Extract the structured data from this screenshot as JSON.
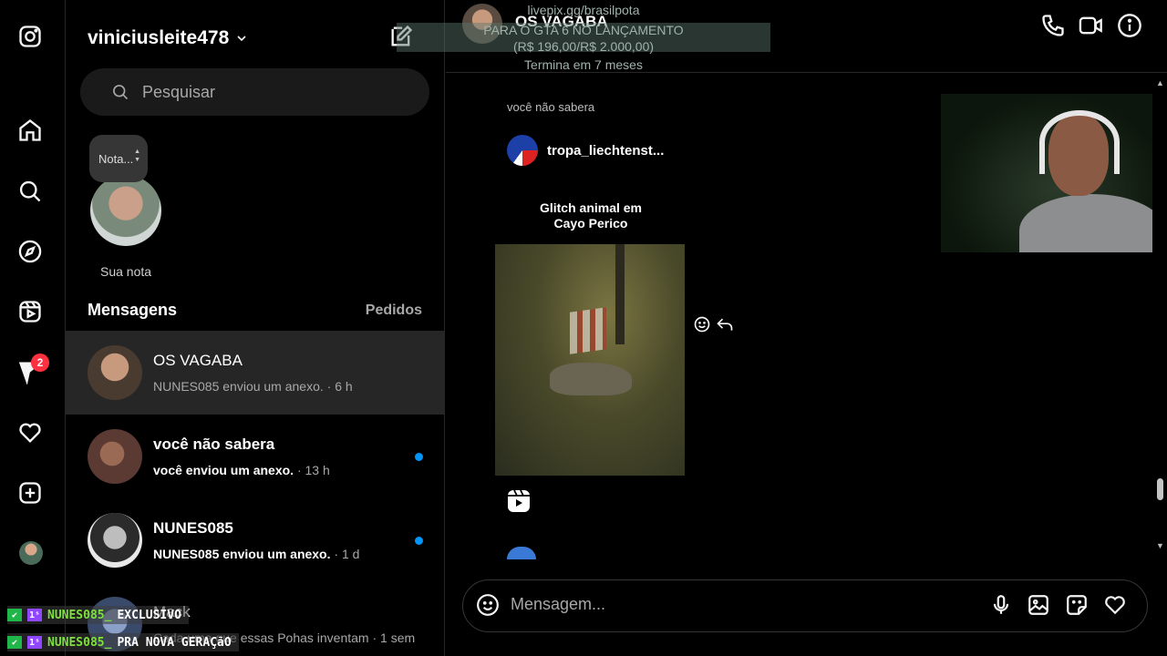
{
  "sidebar": {
    "icons": [
      "instagram-icon",
      "home-icon",
      "search-icon",
      "explore-icon",
      "reels-icon",
      "messages-icon",
      "heart-icon",
      "create-icon",
      "profile-avatar"
    ],
    "messages_badge": "2"
  },
  "panel": {
    "username": "viniciusleite478",
    "search_placeholder": "Pesquisar",
    "note_bubble": "Nota...",
    "note_label": "Sua nota",
    "section_title": "Mensagens",
    "requests_link": "Pedidos",
    "conversations": [
      {
        "name": "OS VAGABA",
        "last": "NUNES085 enviou um anexo.",
        "time": "· 6 h",
        "unread": false,
        "active": true
      },
      {
        "name": "você não sabera",
        "last": "você enviou um anexo.",
        "time": "· 13 h",
        "unread": true,
        "active": false
      },
      {
        "name": "NUNES085",
        "last": "NUNES085 enviou um anexo.",
        "time": "· 1 d",
        "unread": true,
        "active": false
      },
      {
        "name": "Mack",
        "last": "Cada uma que essas Pohas inventam",
        "time": "· 1 sem",
        "unread": false,
        "active": false
      }
    ]
  },
  "chat": {
    "title": "OS VAGABA",
    "sender_meta": "você não sabera",
    "shared_user": "tropa_liechtenst...",
    "reel_title_line1": "Glitch animal em",
    "reel_title_line2": "Cayo Perico",
    "composer_placeholder": "Mensagem..."
  },
  "overlay": {
    "url": "livepix.gg/brasilpota",
    "line2": "PARA O GTA 6 NO LANÇAMENTO",
    "line3": "(R$ 196,00/R$ 2.000,00)",
    "line4": "Termina em 7 meses"
  },
  "stream_chat": [
    {
      "user": "NUNES085_",
      "msg": "EXCLUSIVO"
    },
    {
      "user": "NUNES085_",
      "msg": "PRA NOVA GERAÇãO"
    }
  ],
  "colors": {
    "accent": "#0095f6",
    "badge": "#ff3040",
    "active_row": "#262626"
  }
}
